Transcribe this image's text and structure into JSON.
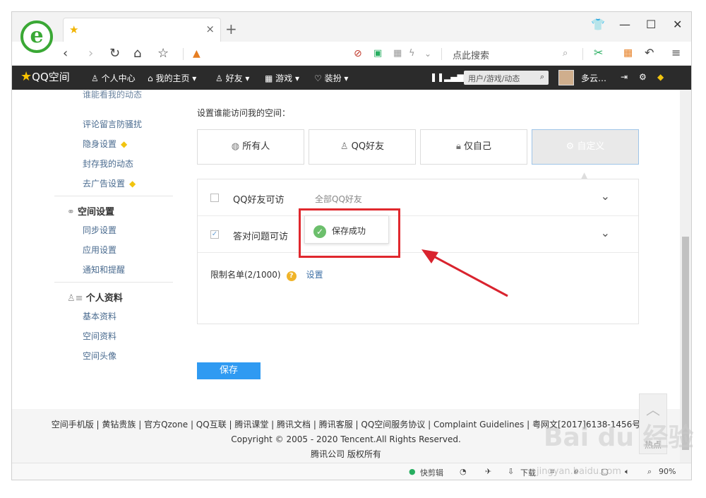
{
  "browser": {
    "tab_close": "×",
    "newtab": "+",
    "search_hint": "点此搜索",
    "zoom": "90%"
  },
  "qzbar": {
    "logo": "QQ空间",
    "items": [
      "个人中心",
      "我的主页",
      "好友",
      "游戏",
      "装扮"
    ],
    "search_placeholder": "用户/游戏/动态",
    "user": "多云…"
  },
  "sidebar": {
    "top_items": [
      "谁能看我的动态",
      "评论留言防骚扰",
      "隐身设置",
      "封存我的动态",
      "去广告设置"
    ],
    "space_heading": "空间设置",
    "space_items": [
      "同步设置",
      "应用设置",
      "通知和提醒"
    ],
    "profile_heading": "个人资料",
    "profile_items": [
      "基本资料",
      "空间资料",
      "空间头像"
    ]
  },
  "main": {
    "label": "设置谁能访问我的空间：",
    "options": [
      "所有人",
      "QQ好友",
      "仅自己",
      "自定义"
    ],
    "rows": [
      {
        "label": "QQ好友可访",
        "sub": "全部QQ好友",
        "checked": false
      },
      {
        "label": "答对问题可访",
        "sub": "",
        "checked": true
      }
    ],
    "limit_label": "限制名单(2/1000)",
    "limit_link": "设置",
    "toast": "保存成功",
    "save": "保存"
  },
  "footer": {
    "line1": "空间手机版 | 黄钻贵族 | 官方Qzone | QQ互联 | 腾讯课堂 | 腾讯文档 | 腾讯客服 | QQ空间服务协议 | Complaint Guidelines | 粤网文[2017]6138-1456号",
    "line2": "Copyright © 2005 - 2020 Tencent.All Rights Reserved.",
    "line3": "腾讯公司 版权所有",
    "hot": "热点"
  },
  "statusbar": {
    "clip": "快剪辑",
    "download": "下载"
  },
  "watermark": {
    "brand": "Bai du 经验",
    "url": "jingyan.baidu.com"
  }
}
